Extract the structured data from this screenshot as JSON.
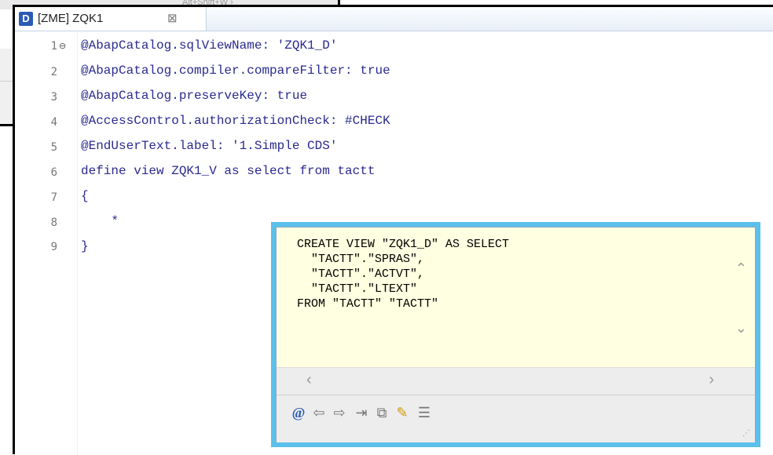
{
  "background": {
    "top_fragment_text": "Alt+Shift+W ›"
  },
  "editor": {
    "tab": {
      "icon_letter": "D",
      "title": "[ZME] ZQK1",
      "close_glyph": "⊠"
    },
    "lines": [
      {
        "num": "1",
        "text": "@AbapCatalog.sqlViewName: 'ZQK1_D'"
      },
      {
        "num": "2",
        "text": "@AbapCatalog.compiler.compareFilter: true"
      },
      {
        "num": "3",
        "text": "@AbapCatalog.preserveKey: true"
      },
      {
        "num": "4",
        "text": "@AccessControl.authorizationCheck: #CHECK"
      },
      {
        "num": "5",
        "text": "@EndUserText.label: '1.Simple CDS'"
      },
      {
        "num": "6",
        "text": "define view ZQK1_V as select from tactt"
      },
      {
        "num": "7",
        "text": "{"
      },
      {
        "num": "8",
        "text": "    *"
      },
      {
        "num": "9",
        "text": "}"
      }
    ]
  },
  "popup": {
    "sql_lines": [
      "CREATE VIEW \"ZQK1_D\" AS SELECT",
      "  \"TACTT\".\"SPRAS\",",
      "  \"TACTT\".\"ACTVT\",",
      "  \"TACTT\".\"LTEXT\"",
      "FROM \"TACTT\" \"TACTT\""
    ],
    "toolbar_icons": [
      "at-icon",
      "back-icon",
      "forward-icon",
      "open-input-icon",
      "link-icon",
      "pin-icon",
      "outline-icon"
    ]
  }
}
